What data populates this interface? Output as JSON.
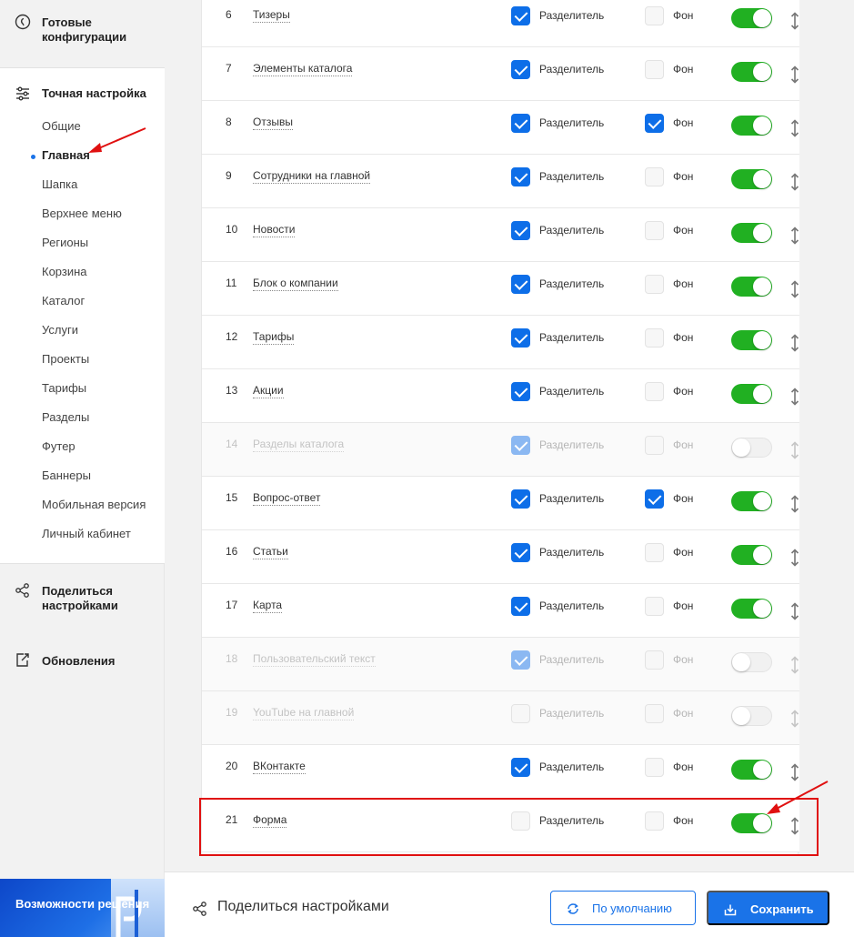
{
  "sidebar": {
    "ready_configs": "Готовые конфигурации",
    "fine_tune": "Точная настройка",
    "items": [
      "Общие",
      "Главная",
      "Шапка",
      "Верхнее меню",
      "Регионы",
      "Корзина",
      "Каталог",
      "Услуги",
      "Проекты",
      "Тарифы",
      "Разделы",
      "Футер",
      "Баннеры",
      "Мобильная версия",
      "Личный кабинет"
    ],
    "active_index": 1,
    "share": "Поделиться настройками",
    "updates": "Обновления",
    "promo": "Возможности решения"
  },
  "labels": {
    "divider": "Разделитель",
    "background": "Фон"
  },
  "rows": [
    {
      "num": "6",
      "name": "Тизеры",
      "divider": true,
      "bg": false,
      "on": true,
      "disabled": false
    },
    {
      "num": "7",
      "name": "Элементы каталога",
      "divider": true,
      "bg": false,
      "on": true,
      "disabled": false
    },
    {
      "num": "8",
      "name": "Отзывы",
      "divider": true,
      "bg": true,
      "on": true,
      "disabled": false
    },
    {
      "num": "9",
      "name": "Сотрудники на главной",
      "divider": true,
      "bg": false,
      "on": true,
      "disabled": false
    },
    {
      "num": "10",
      "name": "Новости",
      "divider": true,
      "bg": false,
      "on": true,
      "disabled": false
    },
    {
      "num": "11",
      "name": "Блок о компании",
      "divider": true,
      "bg": false,
      "on": true,
      "disabled": false
    },
    {
      "num": "12",
      "name": "Тарифы",
      "divider": true,
      "bg": false,
      "on": true,
      "disabled": false
    },
    {
      "num": "13",
      "name": "Акции",
      "divider": true,
      "bg": false,
      "on": true,
      "disabled": false
    },
    {
      "num": "14",
      "name": "Разделы каталога",
      "divider": true,
      "bg": false,
      "on": false,
      "disabled": true
    },
    {
      "num": "15",
      "name": "Вопрос-ответ",
      "divider": true,
      "bg": true,
      "on": true,
      "disabled": false
    },
    {
      "num": "16",
      "name": "Статьи",
      "divider": true,
      "bg": false,
      "on": true,
      "disabled": false
    },
    {
      "num": "17",
      "name": "Карта",
      "divider": true,
      "bg": false,
      "on": true,
      "disabled": false
    },
    {
      "num": "18",
      "name": "Пользовательский текст",
      "divider": true,
      "bg": false,
      "on": false,
      "disabled": true
    },
    {
      "num": "19",
      "name": "YouTube на главной",
      "divider": false,
      "bg": false,
      "on": false,
      "disabled": true
    },
    {
      "num": "20",
      "name": "ВКонтакте",
      "divider": true,
      "bg": false,
      "on": true,
      "disabled": false
    },
    {
      "num": "21",
      "name": "Форма",
      "divider": false,
      "bg": false,
      "on": true,
      "disabled": false
    }
  ],
  "bottom": {
    "share": "Поделиться настройками",
    "default_btn": "По умолчанию",
    "save_btn": "Сохранить"
  },
  "colors": {
    "accent": "#1a73e8",
    "toggle_on": "#21b022",
    "highlight": "#e01010"
  }
}
